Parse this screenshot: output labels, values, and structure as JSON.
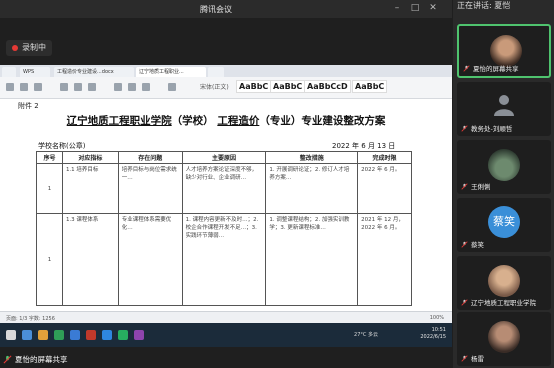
{
  "app": {
    "title": "腾讯会议"
  },
  "recording": {
    "label": "录制中"
  },
  "panel": {
    "header": "正在讲话: 夏恺"
  },
  "participants": [
    {
      "name": "夏怡的屏幕共享",
      "avatar": "photo",
      "mic": "muted"
    },
    {
      "name": "教务处-刘顺哲",
      "avatar": "user-icon",
      "mic": "muted"
    },
    {
      "name": "王俐俐",
      "avatar": "photo",
      "mic": "muted"
    },
    {
      "name": "蔡笑",
      "avatar": "蔡笑",
      "mic": "muted"
    },
    {
      "name": "辽宁地质工程职业学院",
      "avatar": "photo",
      "mic": "muted"
    },
    {
      "name": "杨雷",
      "avatar": "photo",
      "mic": "muted"
    }
  ],
  "screen_share": {
    "banner": "夏怡的屏幕共享"
  },
  "browser_tabs": [
    "",
    "WPS",
    "工程造价专业建设...docx",
    "辽宁地质工程职业...",
    ""
  ],
  "ribbon": {
    "font": "宋体(正文)",
    "styles": [
      "AaBbC",
      "AaBbC",
      "AaBbCcD",
      "AaBbC"
    ]
  },
  "document": {
    "annex": "附件 2",
    "title_parts": [
      "辽宁地质工程职业学院",
      "（学校）",
      "工程造价",
      "（专业）专业建设整改方案"
    ],
    "school_label": "学校名称(公章)",
    "date_line": "2022 年  6  月  13  日",
    "table": {
      "headers": [
        "序号",
        "对应指标",
        "存在问题",
        "主要原因",
        "整改措施",
        "完成时限"
      ],
      "rows": [
        {
          "no": "1",
          "indicator": "1.1 培养目标",
          "problem": "培养目标与岗位需求统一…",
          "cause": "人才培养方案论证深度不够，缺少对行业、企业调研…",
          "measure": "1. 开展调研论证；2. 修订人才培养方案…",
          "deadline": "2022 年 6 月。"
        },
        {
          "no": "1",
          "indicator": "1.3 课程体系",
          "problem": "专业课程体系需要优化…",
          "cause": "1. 课程内容更新不及时…；2. 校企合作课程开发不足…；3. 实践环节薄弱…",
          "measure": "1. 调整课程结构；2. 加强实训教学；3. 更新课程标准…",
          "deadline": "2021 年 12 月，2022 年 6 月。"
        }
      ]
    }
  },
  "doc_status": {
    "left": "页面: 1/3  字数: 1256",
    "right": "100%"
  },
  "taskbar": {
    "weather": "27°C 多云",
    "time": "10:51",
    "date": "2022/6/15"
  }
}
